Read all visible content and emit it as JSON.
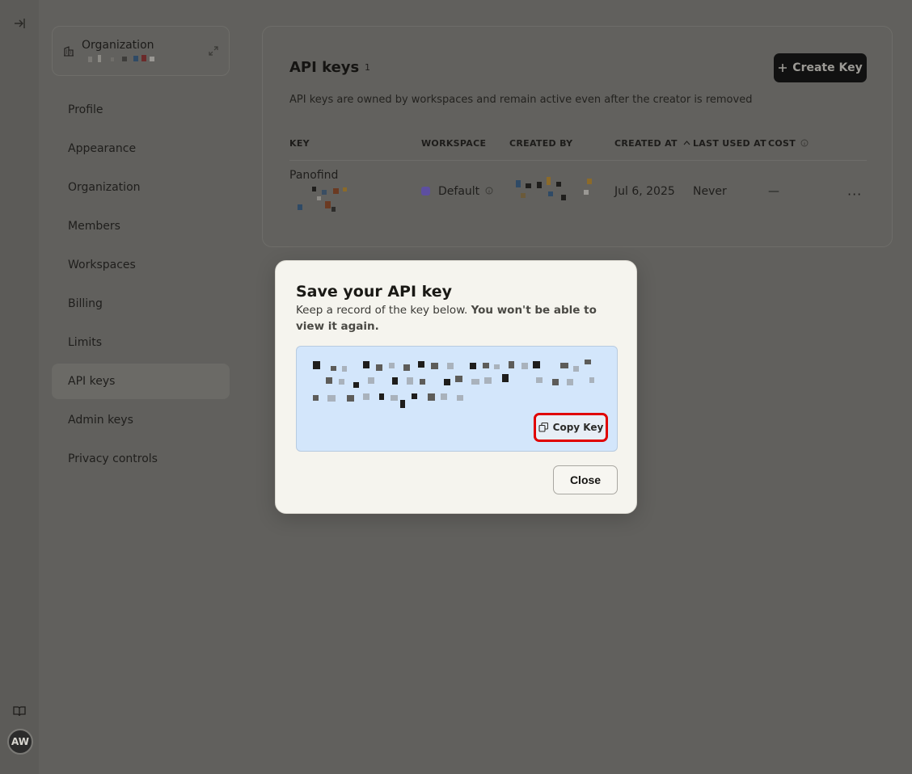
{
  "sidebar": {
    "org_label": "Organization",
    "items": [
      {
        "label": "Profile"
      },
      {
        "label": "Appearance"
      },
      {
        "label": "Organization"
      },
      {
        "label": "Members"
      },
      {
        "label": "Workspaces"
      },
      {
        "label": "Billing"
      },
      {
        "label": "Limits"
      },
      {
        "label": "API keys"
      },
      {
        "label": "Admin keys"
      },
      {
        "label": "Privacy controls"
      }
    ],
    "active_index": 7
  },
  "rail": {
    "avatar_initials": "AW",
    "icons": [
      "collapse-sidebar-icon",
      "book-icon"
    ]
  },
  "api_keys": {
    "title": "API keys",
    "count": "1",
    "create_label": "Create Key",
    "subtitle": "API keys are owned by workspaces and remain active even after the creator is removed",
    "columns": [
      "KEY",
      "WORKSPACE",
      "CREATED BY",
      "CREATED AT",
      "LAST USED AT",
      "COST"
    ],
    "rows": [
      {
        "key_name": "Panofind",
        "workspace": "Default",
        "created_at": "Jul 6, 2025",
        "last_used": "Never",
        "cost": "—",
        "more": "···"
      }
    ]
  },
  "modal": {
    "title": "Save your API key",
    "desc_plain": "Keep a record of the key below. ",
    "desc_bold": "You won't be able to view it again.",
    "copy_label": "Copy Key",
    "close_label": "Close"
  },
  "colors": {
    "overlay": "#5f5e5b",
    "modal_bg": "#f5f4ee",
    "key_box_bg": "#d3e6fb",
    "highlight": "#e00000",
    "workspace_dot": "#5d4fa0"
  }
}
